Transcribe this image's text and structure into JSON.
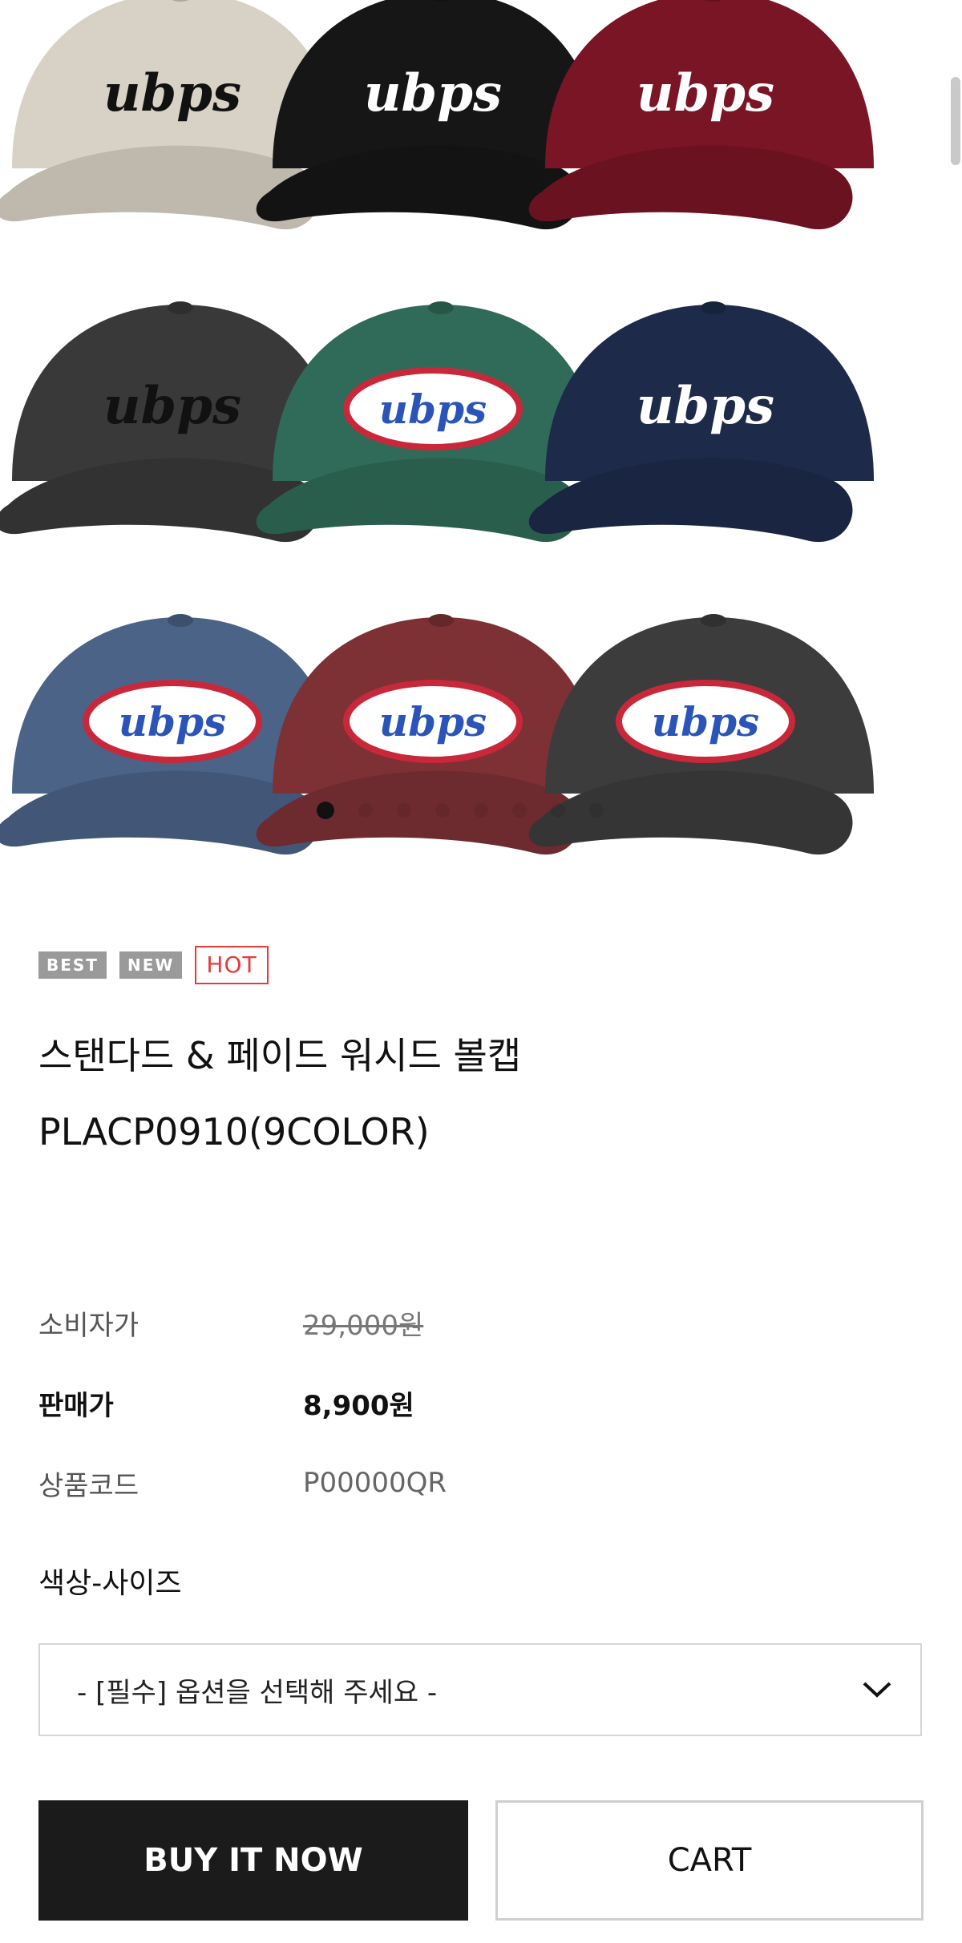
{
  "gallery": {
    "image_alt": "9색 볼캡 이미지",
    "logo_text": "ubps",
    "colors": [
      "#d8d1c5",
      "#161616",
      "#7a1525",
      "#3a3939",
      "#2f6b58",
      "#1d2a4a",
      "#4b6387",
      "#7d3135",
      "#3c3c3c"
    ],
    "slide_count": 8,
    "active_slide": 1
  },
  "badges": {
    "best": "BEST",
    "new": "NEW",
    "hot": "HOT"
  },
  "product": {
    "title_line1": "스탠다드 & 페이드 워시드 볼캡",
    "title_line2": "PLACP0910(9COLOR)"
  },
  "info": {
    "msrp_label": "소비자가",
    "msrp_value": "29,000원",
    "price_label": "판매가",
    "price_value": "8,900원",
    "code_label": "상품코드",
    "code_value": "P00000QR"
  },
  "options": {
    "label": "색상-사이즈",
    "placeholder": "- [필수] 옵션을 선택해 주세요 -"
  },
  "actions": {
    "buy_now": "BUY IT NOW",
    "cart": "CART"
  },
  "accent_colors": {
    "buy_bg": "#1b1b1b",
    "hot": "#e43b3b"
  }
}
